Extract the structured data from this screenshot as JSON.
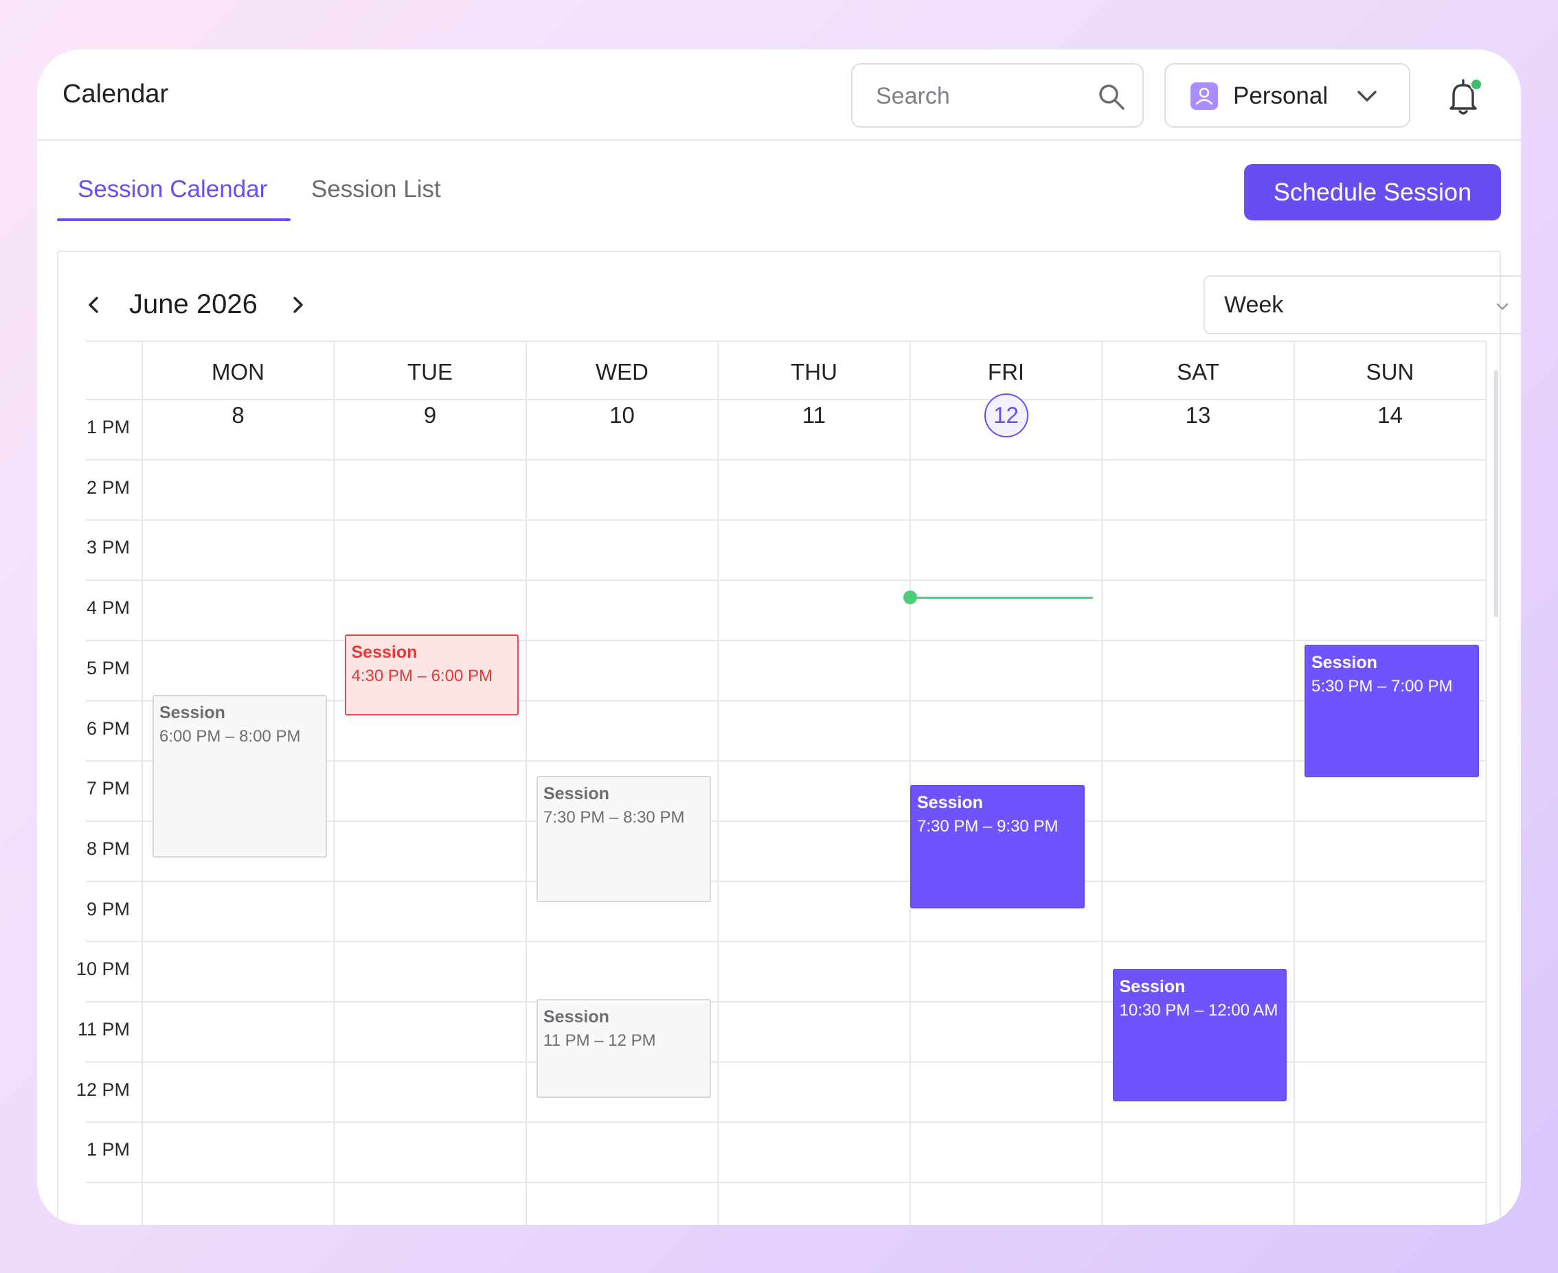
{
  "header": {
    "title": "Calendar",
    "search_placeholder": "Search",
    "account_label": "Personal",
    "icons": {
      "search": "search-icon",
      "account": "user-icon",
      "chevron": "chevron-down-icon",
      "notifications": "bell-icon"
    }
  },
  "tabs": [
    {
      "label": "Session Calendar",
      "active": true
    },
    {
      "label": "Session List",
      "active": false
    }
  ],
  "schedule_button": "Schedule Session",
  "calendar": {
    "month_label": "June 2026",
    "view": "Week",
    "days": [
      {
        "name": "MON",
        "num": "8"
      },
      {
        "name": "TUE",
        "num": "9"
      },
      {
        "name": "WED",
        "num": "10"
      },
      {
        "name": "THU",
        "num": "11"
      },
      {
        "name": "FRI",
        "num": "12",
        "today": true
      },
      {
        "name": "SAT",
        "num": "13"
      },
      {
        "name": "SUN",
        "num": "14"
      }
    ],
    "hours": [
      "1 PM",
      "2 PM",
      "3 PM",
      "4 PM",
      "5 PM",
      "6 PM",
      "7 PM",
      "8 PM",
      "9 PM",
      "10 PM",
      "11 PM",
      "12 PM",
      "1 PM"
    ],
    "events": [
      {
        "day": 1,
        "title": "Session",
        "time": "4:30 PM – 6:00 PM",
        "style": "red",
        "start": 3.9,
        "end": 5.25
      },
      {
        "day": 0,
        "title": "Session",
        "time": "6:00 PM – 8:00 PM",
        "style": "grey",
        "start": 4.9,
        "end": 7.6
      },
      {
        "day": 2,
        "title": "Session",
        "time": "7:30 PM – 8:30 PM",
        "style": "grey",
        "start": 6.25,
        "end": 8.35
      },
      {
        "day": 2,
        "title": "Session",
        "time": "11 PM – 12 PM",
        "style": "grey",
        "start": 9.95,
        "end": 11.6
      },
      {
        "day": 4,
        "title": "Session",
        "time": "7:30 PM – 9:30 PM",
        "style": "purple",
        "start": 6.4,
        "end": 8.45
      },
      {
        "day": 5,
        "title": "Session",
        "time": "10:30 PM – 12:00 AM",
        "style": "purple",
        "start": 9.45,
        "end": 11.65
      },
      {
        "day": 6,
        "title": "Session",
        "time": "5:30 PM – 7:00 PM",
        "style": "purple",
        "start": 4.07,
        "end": 6.27
      }
    ],
    "now_indicator": {
      "day": 4,
      "time": 3.28,
      "color": "#4ccf78"
    }
  },
  "colors": {
    "accent": "#6a4cf3",
    "event_purple": "#7152ff",
    "event_red": "#e33b3b",
    "now": "#4ccf78"
  }
}
